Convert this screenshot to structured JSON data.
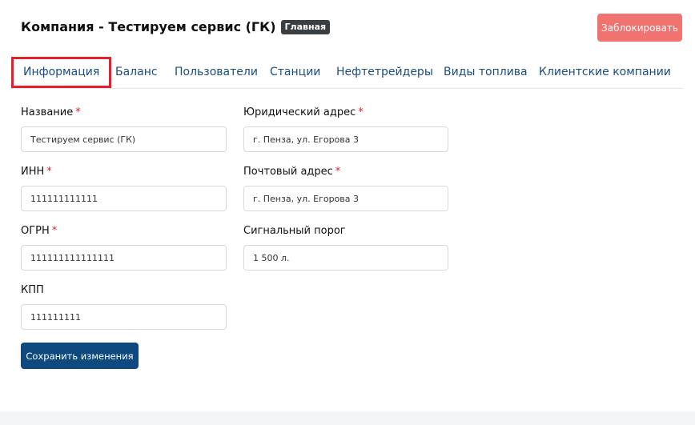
{
  "header": {
    "title": "Компания - Тестируем сервис (ГК)",
    "badge": "Главная",
    "block_button": "Заблокировать"
  },
  "tabs": [
    {
      "label": "Информация",
      "active": true
    },
    {
      "label": "Баланс"
    },
    {
      "label": "Пользователи"
    },
    {
      "label": "Станции"
    },
    {
      "label": "Нефтетрейдеры"
    },
    {
      "label": "Виды топлива"
    },
    {
      "label": "Клиентские компании"
    }
  ],
  "form": {
    "name": {
      "label": "Название",
      "required": "*",
      "value": "Тестируем сервис (ГК)"
    },
    "inn": {
      "label": "ИНН",
      "required": "*",
      "value": "111111111111"
    },
    "ogrn": {
      "label": "ОГРН",
      "required": "*",
      "value": "111111111111111"
    },
    "kpp": {
      "label": "КПП",
      "value": "111111111"
    },
    "legal_address": {
      "label": "Юридический адрес",
      "required": "*",
      "value": "г. Пенза, ул. Егорова 3"
    },
    "postal_address": {
      "label": "Почтовый адрес",
      "required": "*",
      "value": "г. Пенза, ул. Егорова 3"
    },
    "signal_threshold": {
      "label": "Сигнальный порог",
      "value": "1 500 л."
    },
    "save_button": "Сохранить изменения"
  },
  "colors": {
    "accent": "#0e4a80",
    "danger": "#f07371",
    "highlight_border": "#e3202c",
    "tab_text": "#1a4d7e"
  }
}
